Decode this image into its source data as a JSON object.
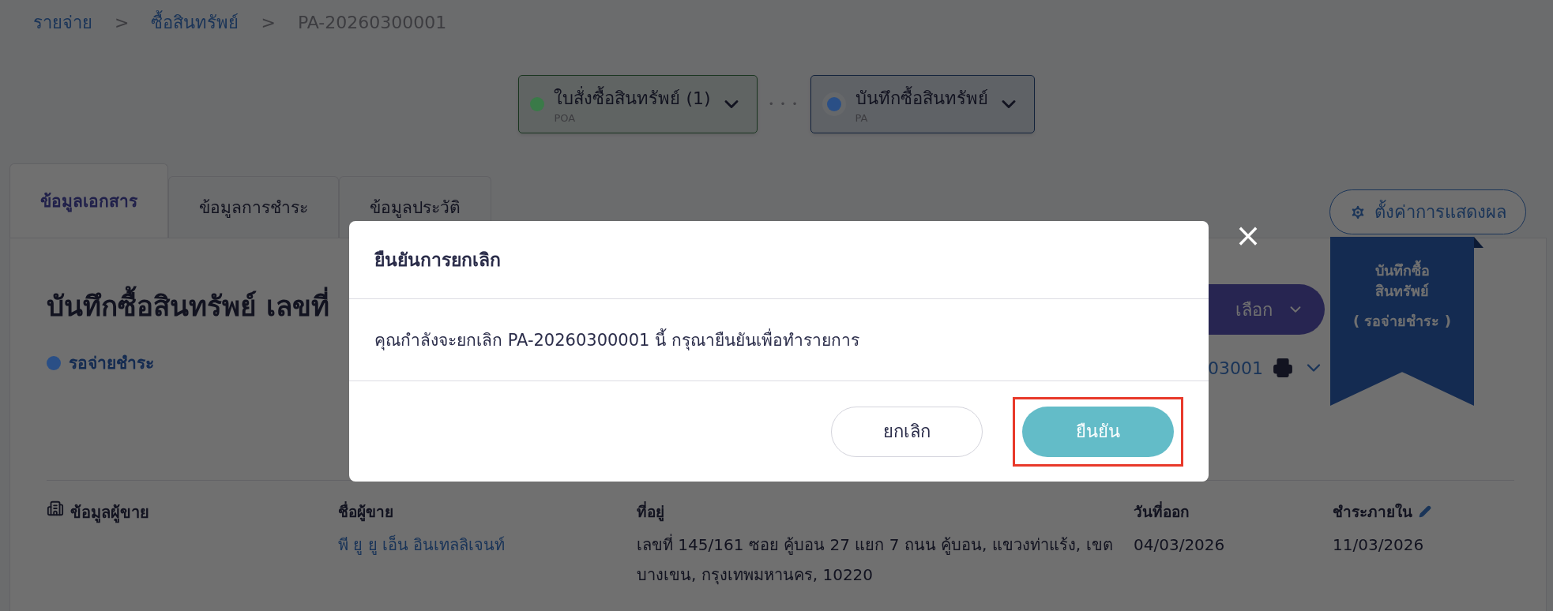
{
  "breadcrumb": [
    {
      "label": "รายจ่าย",
      "kind": "link"
    },
    {
      "label": ">",
      "kind": "separator"
    },
    {
      "label": "ซื้อสินทรัพย์",
      "kind": "link"
    },
    {
      "label": ">",
      "kind": "separator"
    },
    {
      "label": "PA-20260300001",
      "kind": "current"
    }
  ],
  "flow": [
    {
      "title": "ใบสั่งซื้อสินทรัพย์",
      "count": "(1)",
      "code": "POA",
      "color": "#3a7a48",
      "selected": false
    },
    {
      "title": "บันทึกซื้อสินทรัพย์",
      "code": "PA",
      "color": "#2a4f86",
      "selected": true
    }
  ],
  "flow_separator": "• • •",
  "tabs": [
    {
      "label": "ข้อมูลเอกสาร",
      "selected": true
    },
    {
      "label": "ข้อมูลการชำระ",
      "selected": false
    },
    {
      "label": "ข้อมูลประวัติ",
      "selected": false
    }
  ],
  "settings_button": "ตั้งค่าการแสดงผล",
  "ribbon": {
    "title": "บันทึกซื้อ สินทรัพย์",
    "status": "( รอจ่ายชำระ )"
  },
  "document": {
    "title": "บันทึกซื้อสินทรัพย์ เลขที่",
    "status": {
      "label": "รอจ่ายชำระ",
      "color": "#2a4f86"
    },
    "options_button": "เลือก",
    "number": "03001"
  },
  "vendor": {
    "heading": "ข้อมูลผู้ขาย",
    "fields": [
      {
        "label": "ชื่อผู้ขาย",
        "value": "พี ยู ยู เอ็น อินเทลลิเจนท์",
        "link": true,
        "editable": false
      },
      {
        "label": "ที่อยู่",
        "value": "เลขที่ 145/161 ซอย คู้บอน 27 แยก 7 ถนน คู้บอน, แขวงท่าแร้ง, เขตบางเขน, กรุงเทพมหานคร, 10220",
        "link": false,
        "editable": false
      },
      {
        "label": "วันที่ออก",
        "value": "04/03/2026",
        "link": false,
        "editable": false
      },
      {
        "label": "ชำระภายใน",
        "value": "11/03/2026",
        "link": false,
        "editable": true
      }
    ]
  },
  "dialog": {
    "title": "ยืนยันการยกเลิก",
    "message": "คุณกำลังจะยกเลิก PA-20260300001 นี้ กรุณายืนยันเพื่อทำรายการ",
    "close": "×",
    "buttons": [
      {
        "label": "ยกเลิก",
        "kind": "secondary",
        "highlighted": false
      },
      {
        "label": "ยืนยัน",
        "kind": "primary",
        "highlighted": true
      }
    ]
  }
}
